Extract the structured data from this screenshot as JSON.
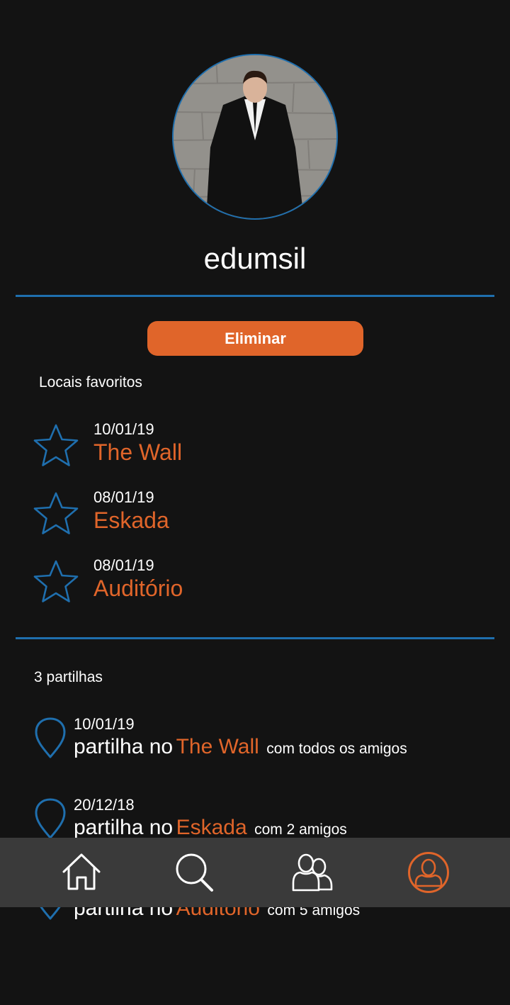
{
  "profile": {
    "username": "edumsil",
    "avatar_icon": "user-photo"
  },
  "actions": {
    "delete_label": "Eliminar"
  },
  "favorites": {
    "heading": "Locais favoritos",
    "items": [
      {
        "date": "10/01/19",
        "place": "The Wall",
        "icon": "star-icon"
      },
      {
        "date": "08/01/19",
        "place": "Eskada",
        "icon": "star-icon"
      },
      {
        "date": "08/01/19",
        "place": "Auditório",
        "icon": "star-icon"
      }
    ]
  },
  "shares": {
    "heading": "3 partilhas",
    "items": [
      {
        "date": "10/01/19",
        "prefix": "partilha no",
        "place": "The Wall",
        "suffix": "com todos os amigos",
        "icon": "map-pin-icon"
      },
      {
        "date": "20/12/18",
        "prefix": "partilha no",
        "place": "Eskada",
        "suffix": "com 2 amigos",
        "icon": "map-pin-icon"
      },
      {
        "date": "",
        "prefix": "partilha no",
        "place": "Auditório",
        "suffix": "com 5 amigos",
        "icon": "map-pin-icon"
      }
    ]
  },
  "navbar": {
    "items": [
      {
        "name": "home",
        "icon": "home-icon",
        "active": false
      },
      {
        "name": "search",
        "icon": "search-icon",
        "active": false
      },
      {
        "name": "friends",
        "icon": "friends-icon",
        "active": false
      },
      {
        "name": "profile",
        "icon": "profile-icon",
        "active": true
      }
    ]
  },
  "colors": {
    "background": "#131313",
    "accent": "#e0652a",
    "blue": "#1f6fae",
    "navbar": "#3a3a3a",
    "text": "#ffffff"
  }
}
